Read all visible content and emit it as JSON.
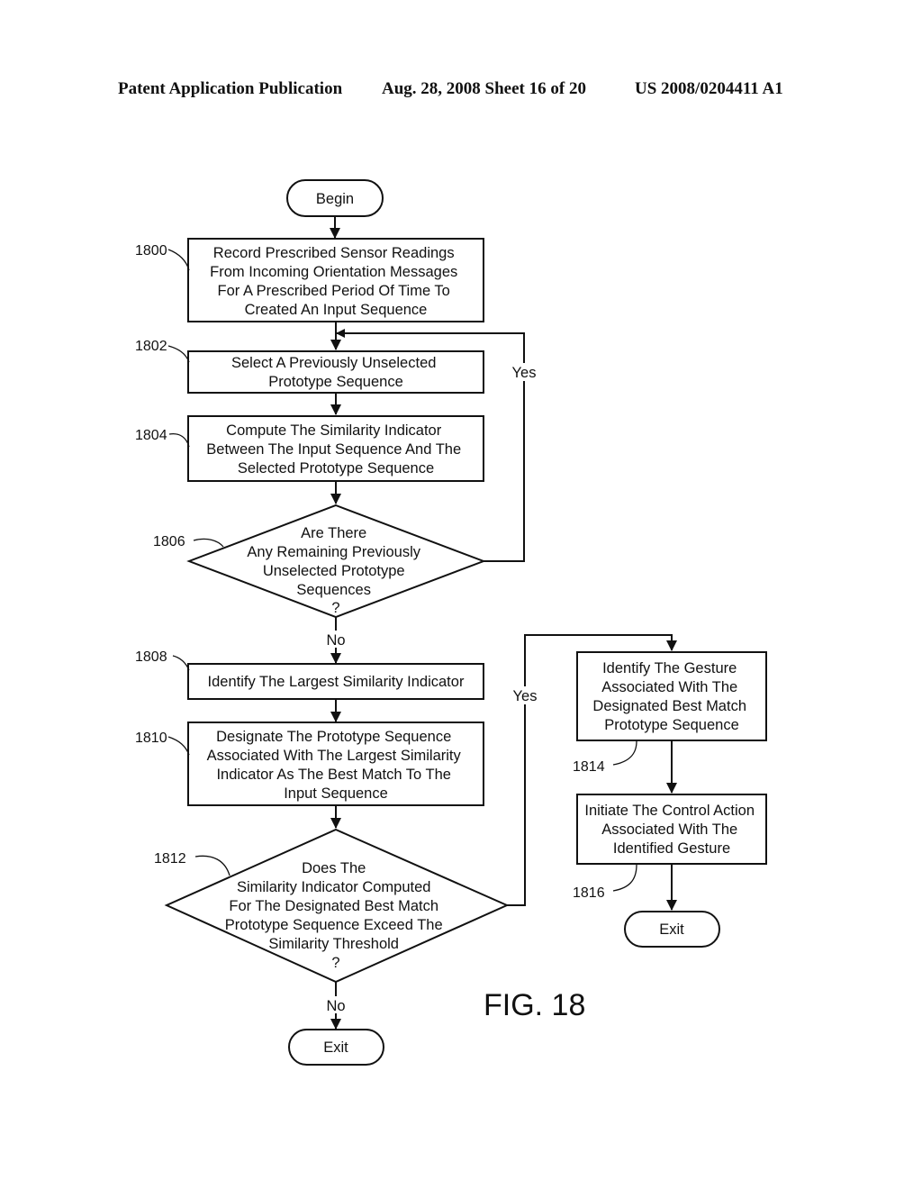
{
  "header": {
    "publication": "Patent Application Publication",
    "date_sheet": "Aug. 28, 2008  Sheet 16 of 20",
    "number": "US 2008/0204411 A1"
  },
  "figure_label": "FIG. 18",
  "terminals": {
    "begin": "Begin",
    "exit_main": "Exit",
    "exit_right": "Exit"
  },
  "steps": [
    {
      "ref": "1800",
      "lines": [
        "Record Prescribed Sensor Readings",
        "From Incoming Orientation Messages",
        "For A Prescribed Period Of Time To",
        "Created An Input Sequence"
      ]
    },
    {
      "ref": "1802",
      "lines": [
        "Select A Previously Unselected",
        "Prototype Sequence"
      ]
    },
    {
      "ref": "1804",
      "lines": [
        "Compute The Similarity Indicator",
        "Between The Input Sequence And The",
        "Selected Prototype Sequence"
      ]
    },
    {
      "ref": "1806",
      "lines": [
        "Are There",
        "Any Remaining Previously",
        "Unselected Prototype",
        "Sequences",
        "?"
      ]
    },
    {
      "ref": "1808",
      "lines": [
        "Identify The Largest Similarity Indicator"
      ]
    },
    {
      "ref": "1810",
      "lines": [
        "Designate The Prototype Sequence",
        "Associated With The Largest Similarity",
        "Indicator As The Best Match To The",
        "Input Sequence"
      ]
    },
    {
      "ref": "1812",
      "lines": [
        "Does The",
        "Similarity Indicator Computed",
        "For The Designated Best Match",
        "Prototype Sequence Exceed The",
        "Similarity Threshold",
        "?"
      ]
    },
    {
      "ref": "1814",
      "lines": [
        "Identify The Gesture",
        "Associated With The",
        "Designated Best Match",
        "Prototype Sequence"
      ]
    },
    {
      "ref": "1816",
      "lines": [
        "Initiate The Control Action",
        "Associated With The",
        "Identified Gesture"
      ]
    }
  ],
  "edge_labels": {
    "d1806_yes": "Yes",
    "d1806_no": "No",
    "d1812_yes": "Yes",
    "d1812_no": "No"
  }
}
